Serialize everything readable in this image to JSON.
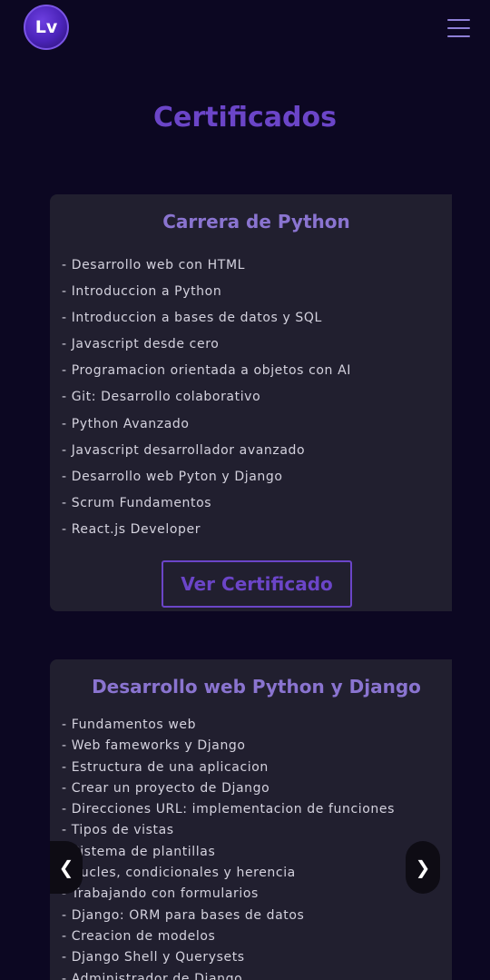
{
  "header": {
    "logo_text": "Lv",
    "menu_icon": "hamburger-menu-icon"
  },
  "page_title": "Certificados",
  "cards": [
    {
      "title": "Carrera de Python",
      "items": [
        "- Desarrollo web con HTML",
        "- Introduccion a Python",
        "- Introduccion a bases de datos y SQL",
        "- Javascript desde cero",
        "- Programacion orientada a objetos con AI",
        "- Git: Desarrollo colaborativo",
        "- Python Avanzado",
        "- Javascript desarrollador avanzado",
        "- Desarrollo web Pyton y Django",
        "- Scrum Fundamentos",
        "- React.js Developer"
      ],
      "button_label": "Ver Certificado"
    },
    {
      "title": "Desarrollo web Python y Django",
      "items": [
        "- Fundamentos web",
        "- Web fameworks y Django",
        "- Estructura de una aplicacion",
        "- Crear un proyecto de Django",
        "- Direcciones URL: implementacion de funciones",
        "- Tipos de vistas",
        "- Sistema de plantillas",
        "- Bucles, condicionales y herencia",
        "- Trabajando con formularios",
        "- Django: ORM para bases de datos",
        "- Creacion de modelos",
        "- Django Shell y Querysets",
        "- Administrador de Django"
      ]
    }
  ],
  "carousel": {
    "prev_label": "❮",
    "next_label": "❯"
  },
  "colors": {
    "background": "#0c0722",
    "accent": "#6b45c8",
    "card_bg": "#211f2f",
    "card_title": "#8a74d0"
  }
}
